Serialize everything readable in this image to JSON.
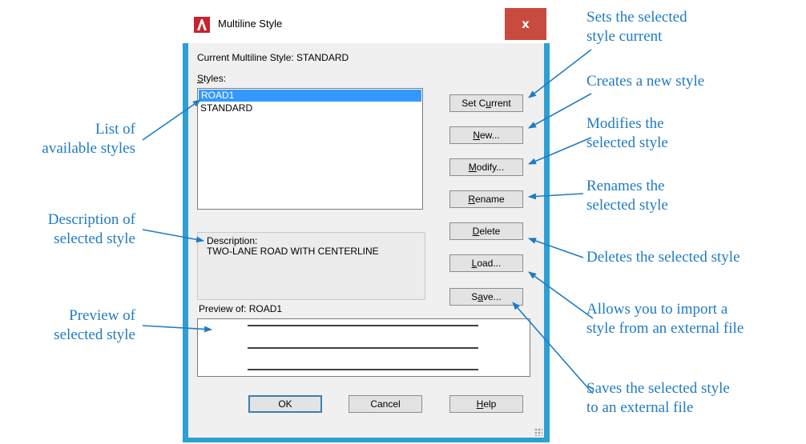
{
  "window": {
    "title": "Multiline Style",
    "close_label": "x"
  },
  "current_style": "Current Multiline Style: STANDARD",
  "styles": {
    "label_accel": "S",
    "label_rest": "tyles:",
    "items": [
      "ROAD1",
      "STANDARD"
    ]
  },
  "description": {
    "label": "Description:",
    "text": "TWO-LANE ROAD WITH CENTERLINE"
  },
  "preview": {
    "label": "Preview of: ROAD1"
  },
  "buttons": {
    "set_current": {
      "pre": "Set C",
      "accel": "u",
      "post": "rrent"
    },
    "new": {
      "pre": "",
      "accel": "N",
      "post": "ew..."
    },
    "modify": {
      "pre": "",
      "accel": "M",
      "post": "odify..."
    },
    "rename": {
      "pre": "",
      "accel": "R",
      "post": "ename"
    },
    "delete": {
      "pre": "",
      "accel": "D",
      "post": "elete"
    },
    "load": {
      "pre": "",
      "accel": "L",
      "post": "oad..."
    },
    "save": {
      "pre": "S",
      "accel": "a",
      "post": "ve..."
    },
    "ok": "OK",
    "cancel": "Cancel",
    "help": {
      "pre": "",
      "accel": "H",
      "post": "elp"
    }
  },
  "annotations": {
    "list_styles": [
      "List of",
      "available styles"
    ],
    "desc_selected": [
      "Description of",
      "selected style"
    ],
    "preview_selected": [
      "Preview of",
      "selected style"
    ],
    "set_current": [
      "Sets the selected",
      "style current"
    ],
    "new_style": [
      "Creates a new style"
    ],
    "modify": [
      "Modifies the",
      "selected style"
    ],
    "rename": [
      "Renames the",
      "selected style"
    ],
    "delete": [
      "Deletes the selected style"
    ],
    "load": [
      "Allows you to import a",
      "style from an external file"
    ],
    "save": [
      "Saves the selected style",
      "to an external file"
    ]
  },
  "colors": {
    "window_border": "#2d9fd3",
    "close_button": "#c94a3f",
    "selection": "#3399ff",
    "annotation": "#1f7bc4"
  }
}
